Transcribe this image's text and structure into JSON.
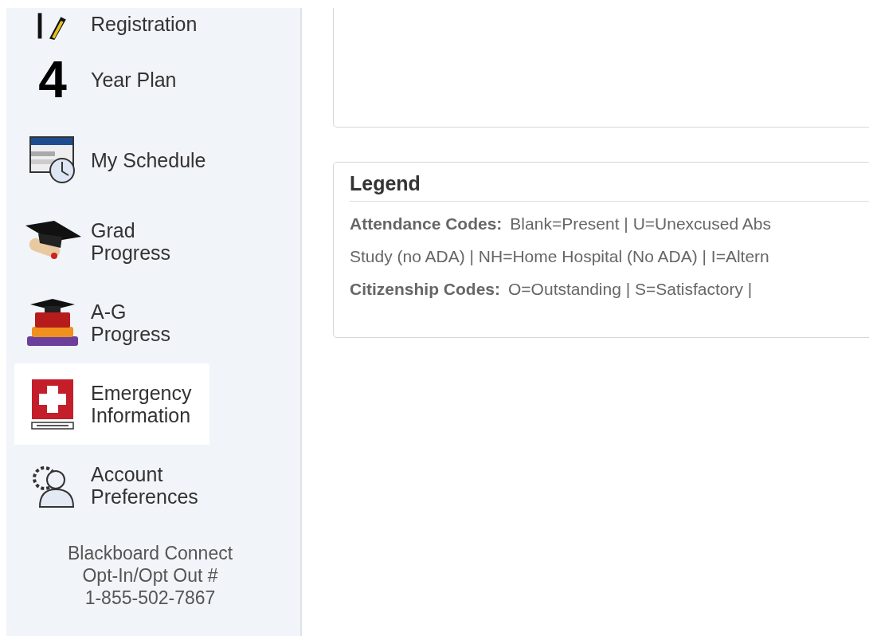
{
  "sidebar": {
    "items": [
      {
        "kind": "registration",
        "label": "Registration",
        "selected": false
      },
      {
        "kind": "four",
        "icon_text": "4",
        "label": "Year Plan",
        "selected": false
      },
      {
        "kind": "schedule",
        "label": "My Schedule",
        "selected": false
      },
      {
        "kind": "grad",
        "label": "Grad Progress",
        "selected": false
      },
      {
        "kind": "books",
        "label": "A-G Progress",
        "selected": false
      },
      {
        "kind": "emergency",
        "label": "Emergency Information",
        "selected": true
      },
      {
        "kind": "account",
        "label": "Account Preferences",
        "selected": false
      }
    ],
    "footer_lines": [
      "Blackboard Connect",
      "Opt-In/Opt Out #",
      "1-855-502-7867"
    ]
  },
  "legend": {
    "title": "Legend",
    "rows": [
      {
        "label": "Attendance Codes:",
        "text": "Blank=Present | U=Unexcused Abs"
      },
      {
        "text": "Study (no ADA) | NH=Home Hospital (No ADA) | I=Altern"
      },
      {
        "label": "Citizenship Codes:",
        "text": "O=Outstanding | S=Satisfactory |"
      }
    ]
  }
}
